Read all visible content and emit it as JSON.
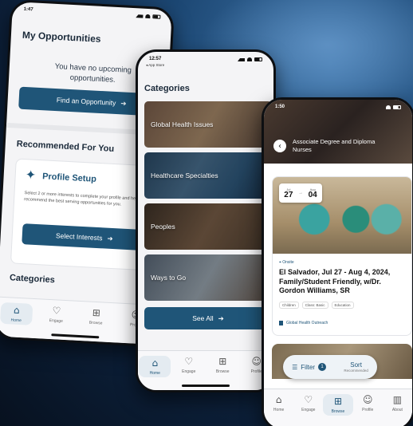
{
  "phone1": {
    "time": "1:47",
    "title": "My Opportunities",
    "empty_text": "You have no upcoming opportunities.",
    "find_button": "Find an Opportunity",
    "recommended_title": "Recommended For You",
    "profile_card_title": "Profile Setup",
    "profile_card_desc": "Select 2 or more interests to complete your profile and help us recommend the best serving opportunities for you.",
    "select_interests_button": "Select Interests",
    "categories_title": "Categories",
    "tabs": [
      "Home",
      "Engage",
      "Browse",
      "Profile"
    ]
  },
  "phone2": {
    "time": "12:57",
    "back_label": "◂ App Store",
    "title": "Categories",
    "categories": [
      "Global Health Issues",
      "Healthcare Specialties",
      "Peoples",
      "Ways to Go"
    ],
    "see_all_button": "See All",
    "tabs": [
      "Home",
      "Engage",
      "Browse",
      "Profile"
    ]
  },
  "phone3": {
    "time": "1:50",
    "hero_title": "Associate Degree and Diploma Nurses",
    "date_start_month": "Jul",
    "date_start_day": "27",
    "date_end_month": "Aug",
    "date_end_day": "04",
    "opp_type": "Onsite",
    "opp_title": "El Salvador, Jul 27 - Aug 4, 2024, Family/Student Friendly, w/Dr. Gordon Williams, SR",
    "tags": [
      "Children",
      "Class: Basic",
      "Education"
    ],
    "opp_category": "Global Health Outreach",
    "filter_label": "Filter",
    "filter_count": "1",
    "sort_label": "Sort",
    "sort_sub": "Recommended",
    "tabs": [
      "Home",
      "Engage",
      "Browse",
      "Profile",
      "About"
    ]
  },
  "colors": {
    "primary": "#1f5578",
    "background": "#f4f4f6"
  },
  "icons": {
    "home": "house-icon",
    "engage": "heart-icon",
    "browse": "grid-icon",
    "profile": "person-icon",
    "about": "book-icon"
  }
}
